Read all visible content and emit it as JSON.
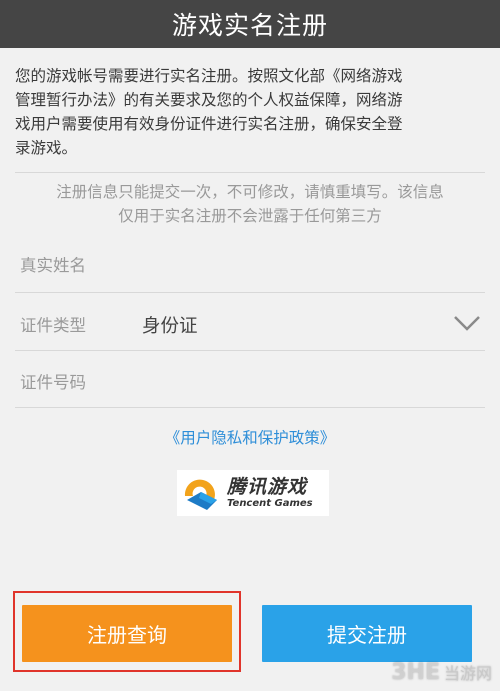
{
  "header": {
    "title": "游戏实名注册"
  },
  "intro": {
    "lines": [
      "您的游戏帐号需要进行实名注册。按照文化部《网络游戏",
      "管理暂行办法》的有关要求及您的个人权益保障，网络游",
      "戏用户需要使用有效身份证件进行实名注册，确保安全登",
      "录游戏。"
    ]
  },
  "notice": {
    "lines": [
      "注册信息只能提交一次，不可修改，请慎重填写。该信息",
      "仅用于实名注册不会泄露于任何第三方"
    ]
  },
  "form": {
    "name_label": "真实姓名",
    "id_type_label": "证件类型",
    "id_type_value": "身份证",
    "id_number_label": "证件号码"
  },
  "policy_link": "《用户隐私和保护政策》",
  "logo": {
    "cn": "腾讯游戏",
    "en": "Tencent Games"
  },
  "buttons": {
    "query": "注册查询",
    "submit": "提交注册"
  },
  "watermark": {
    "brand": "3HE",
    "site": "当游网"
  },
  "colors": {
    "header_bg": "#454545",
    "accent_orange": "#f5921d",
    "accent_blue": "#2aa2e8",
    "link": "#2e8ed8",
    "highlight_border": "#e0342b"
  }
}
